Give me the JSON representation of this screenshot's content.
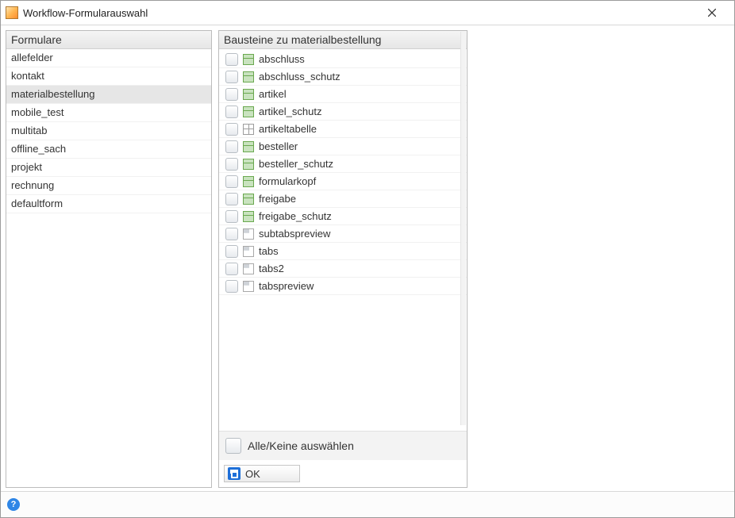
{
  "window": {
    "title": "Workflow-Formularauswahl"
  },
  "left": {
    "header": "Formulare",
    "items": [
      {
        "label": "allefelder",
        "selected": false
      },
      {
        "label": "kontakt",
        "selected": false
      },
      {
        "label": "materialbestellung",
        "selected": true
      },
      {
        "label": "mobile_test",
        "selected": false
      },
      {
        "label": "multitab",
        "selected": false
      },
      {
        "label": "offline_sach",
        "selected": false
      },
      {
        "label": "projekt",
        "selected": false
      },
      {
        "label": "rechnung",
        "selected": false
      },
      {
        "label": "defaultform",
        "selected": false
      }
    ]
  },
  "right": {
    "header": "Bausteine zu materialbestellung",
    "items": [
      {
        "label": "abschluss",
        "icon": "form"
      },
      {
        "label": "abschluss_schutz",
        "icon": "form"
      },
      {
        "label": "artikel",
        "icon": "form"
      },
      {
        "label": "artikel_schutz",
        "icon": "form"
      },
      {
        "label": "artikeltabelle",
        "icon": "grid"
      },
      {
        "label": "besteller",
        "icon": "form"
      },
      {
        "label": "besteller_schutz",
        "icon": "form"
      },
      {
        "label": "formularkopf",
        "icon": "form"
      },
      {
        "label": "freigabe",
        "icon": "form"
      },
      {
        "label": "freigabe_schutz",
        "icon": "form"
      },
      {
        "label": "subtabspreview",
        "icon": "tab"
      },
      {
        "label": "tabs",
        "icon": "tab"
      },
      {
        "label": "tabs2",
        "icon": "tab"
      },
      {
        "label": "tabspreview",
        "icon": "tab"
      }
    ],
    "select_all_label": "Alle/Keine auswählen",
    "ok_label": "OK"
  },
  "help_glyph": "?"
}
